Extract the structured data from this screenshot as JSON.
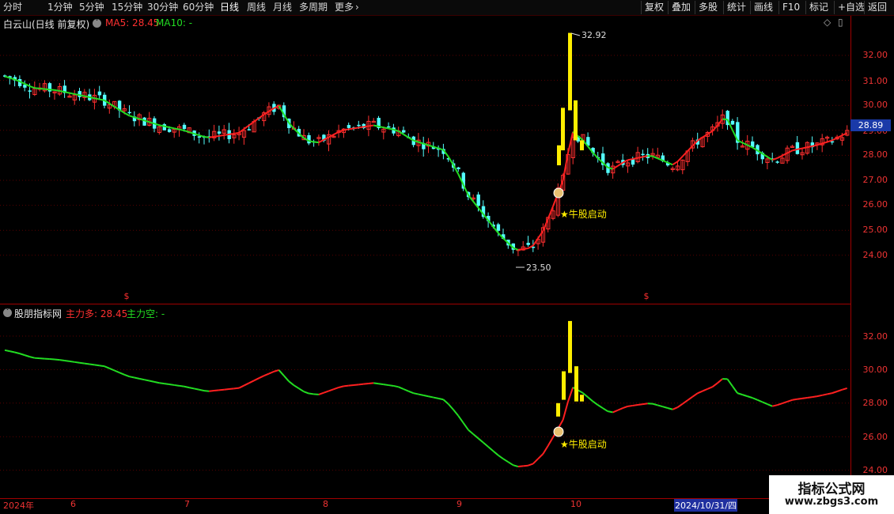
{
  "toolbar": {
    "periods": [
      "分时",
      "1分钟",
      "5分钟",
      "15分钟",
      "30分钟",
      "60分钟",
      "日线",
      "周线",
      "月线",
      "多周期",
      "更多"
    ],
    "active": "日线",
    "right": [
      "复权",
      "叠加",
      "多股",
      "统计",
      "画线",
      "F10",
      "标记",
      "+自选",
      "返回"
    ]
  },
  "main_panel": {
    "title": "白云山(日线 前复权)",
    "ma5_label": "MA5: 28.45",
    "ma10_label": "MA10: -",
    "high_label": "32.92",
    "low_label": "23.50",
    "signal_label": "★牛股启动",
    "current_price": "28.89",
    "y_ticks": [
      "32.00",
      "31.00",
      "30.00",
      "29.00",
      "28.00",
      "27.00",
      "26.00",
      "25.00",
      "24.00"
    ]
  },
  "indicator_panel": {
    "title": "股朋指标网",
    "bull_label": "主力多: 28.45",
    "bear_label": "主力空: -",
    "signal_label": "★牛股启动",
    "y_ticks": [
      "32.00",
      "30.00",
      "28.00",
      "26.00",
      "24.00"
    ]
  },
  "dates": [
    "2024年",
    "6",
    "7",
    "8",
    "9",
    "10"
  ],
  "cursor_date": "2024/10/31/四",
  "watermark": {
    "line1": "指标公式网",
    "line2": "www.zbgs3.com"
  },
  "colors": {
    "up": "#ff3030",
    "down": "#54ffff",
    "ma_up": "#ff2020",
    "ma_down": "#22dd22",
    "signal": "#ffee00"
  },
  "chart_data": {
    "type": "candlestick",
    "ylim": [
      23.5,
      33.0
    ],
    "high": 32.92,
    "low": 23.5,
    "last": 28.89
  }
}
